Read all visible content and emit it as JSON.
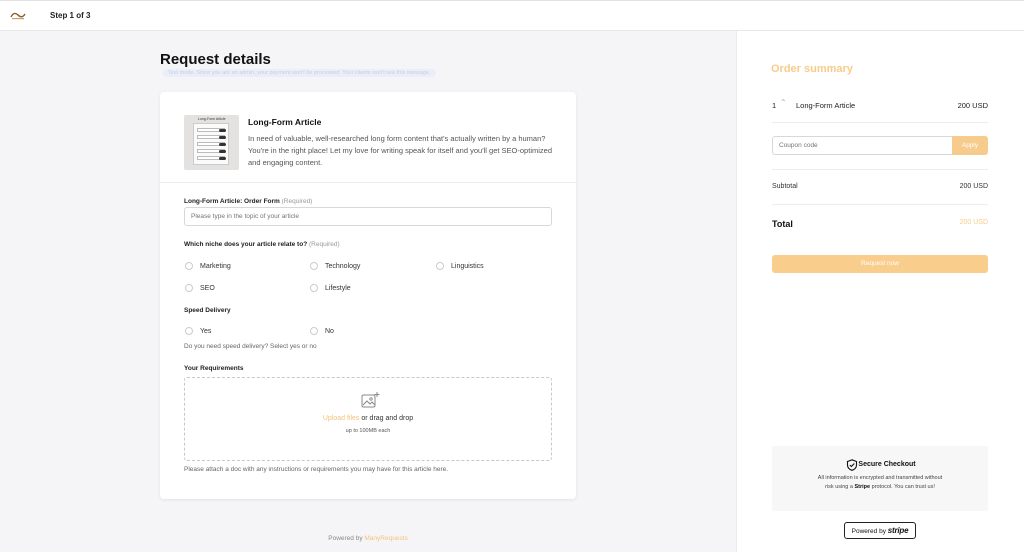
{
  "header": {
    "step_label": "Step 1 of 3"
  },
  "page": {
    "title": "Request details",
    "test_note": "Test mode. Since you are an admin, your payment won't be processed. Your clients won't see this message."
  },
  "product": {
    "image_title": "Long-Form Article",
    "title": "Long-Form Article",
    "description": "In need of valuable, well-researched long form content that's actually written by a human? You're in the right place! Let my love for writing speak for itself and you'll get SEO-optimized and engaging content."
  },
  "form": {
    "topic": {
      "label": "Long-Form Article: Order Form",
      "required": "(Required)",
      "placeholder": "Please type in the topic of your article"
    },
    "niche": {
      "label": "Which niche does your article relate to?",
      "required": "(Required)",
      "options": [
        "Marketing",
        "Technology",
        "Linguistics",
        "SEO",
        "Lifestyle"
      ]
    },
    "speed": {
      "label": "Speed Delivery",
      "options": [
        "Yes",
        "No"
      ],
      "hint": "Do you need speed delivery? Select yes or no"
    },
    "requirements": {
      "label": "Your Requirements",
      "upload_link": "Upload files",
      "upload_text": " or drag and drop",
      "upload_sub": "up to 100MB each",
      "hint": "Please attach a doc with any instructions or requirements you may have for this article here."
    }
  },
  "footer": {
    "powered_prefix": "Powered by ",
    "powered_brand": "ManyRequests"
  },
  "summary": {
    "title": "Order summary",
    "line": {
      "qty": "1",
      "item": "Long-Form Article",
      "price": "200 USD"
    },
    "coupon_placeholder": "Coupon code",
    "apply_label": "Apply",
    "subtotal_label": "Subtotal",
    "subtotal_value": "200 USD",
    "total_label": "Total",
    "total_value": "200 USD",
    "request_label": "Request now"
  },
  "secure": {
    "title": "Secure Checkout",
    "text_before": "All information is encrypted and transmitted without risk using a ",
    "text_brand": "Stripe",
    "text_after": " protocol. You can trust us!"
  },
  "badge": {
    "prefix": "Powered by ",
    "brand": "stripe"
  },
  "colors": {
    "accent": "#f7cb8b",
    "page_bg": "#f5f5f7"
  }
}
